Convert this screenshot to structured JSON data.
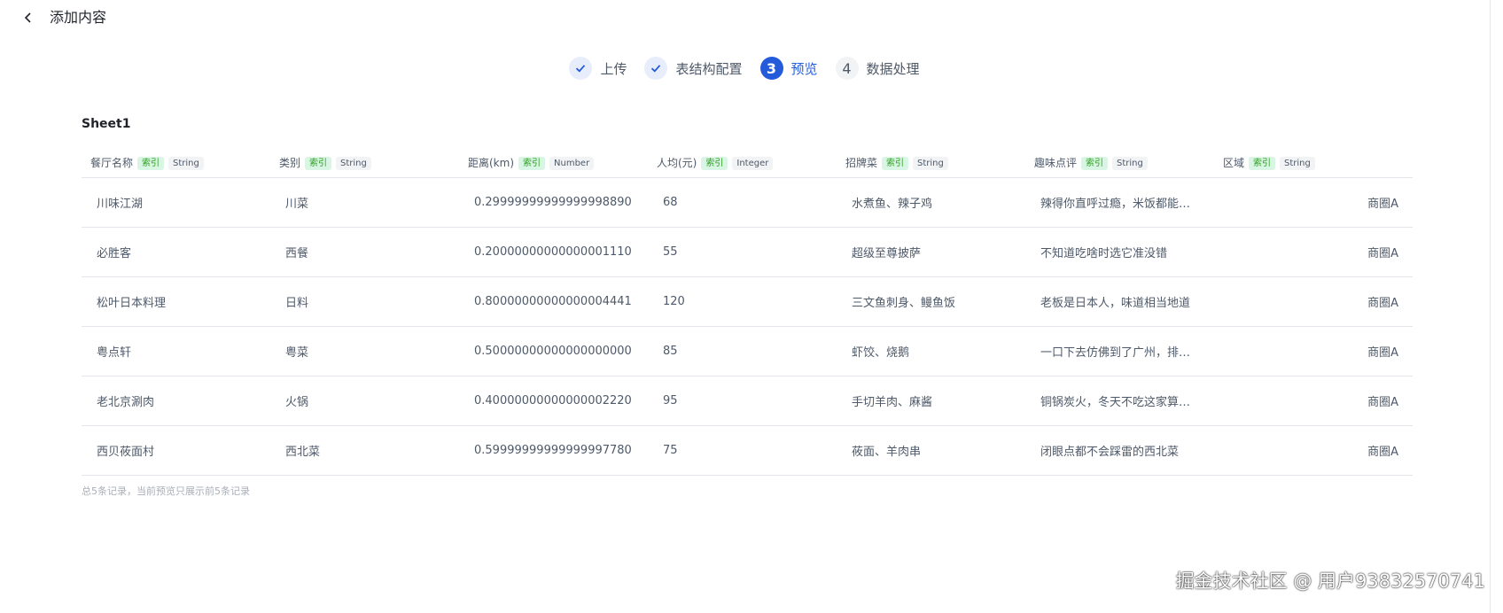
{
  "header": {
    "title": "添加内容"
  },
  "steps": [
    {
      "label": "上传",
      "state": "done"
    },
    {
      "label": "表结构配置",
      "state": "done"
    },
    {
      "number": "3",
      "label": "预览",
      "state": "active"
    },
    {
      "number": "4",
      "label": "数据处理",
      "state": "todo"
    }
  ],
  "sheet": {
    "name": "Sheet1"
  },
  "tags": {
    "index": "索引"
  },
  "columns": [
    {
      "name": "餐厅名称",
      "type": "String"
    },
    {
      "name": "类别",
      "type": "String"
    },
    {
      "name": "距离(km)",
      "type": "Number"
    },
    {
      "name": "人均(元)",
      "type": "Integer"
    },
    {
      "name": "招牌菜",
      "type": "String"
    },
    {
      "name": "趣味点评",
      "type": "String"
    },
    {
      "name": "区域",
      "type": "String"
    }
  ],
  "rows": [
    [
      "川味江湖",
      "川菜",
      "0.29999999999999998890",
      "68",
      "水煮鱼、辣子鸡",
      "辣得你直呼过瘾，米饭都能…",
      "商圈A"
    ],
    [
      "必胜客",
      "西餐",
      "0.20000000000000001110",
      "55",
      "超级至尊披萨",
      "不知道吃啥时选它准没错",
      "商圈A"
    ],
    [
      "松叶日本料理",
      "日料",
      "0.80000000000000004441",
      "120",
      "三文鱼刺身、鳗鱼饭",
      "老板是日本人，味道相当地道",
      "商圈A"
    ],
    [
      "粤点轩",
      "粤菜",
      "0.50000000000000000000",
      "85",
      "虾饺、烧鹅",
      "一口下去仿佛到了广州，排…",
      "商圈A"
    ],
    [
      "老北京涮肉",
      "火锅",
      "0.40000000000000002220",
      "95",
      "手切羊肉、麻酱",
      "铜锅炭火，冬天不吃这家算…",
      "商圈A"
    ],
    [
      "西贝莜面村",
      "西北菜",
      "0.59999999999999997780",
      "75",
      "莜面、羊肉串",
      "闭眼点都不会踩雷的西北菜",
      "商圈A"
    ]
  ],
  "footnote": "总5条记录，当前预览只展示前5条记录",
  "watermark": "掘金技术社区 @ 用户93832570741",
  "colors": {
    "accent": "#245bdb",
    "index_tag_bg": "#d9f5e3",
    "index_tag_text": "#2ea121"
  }
}
